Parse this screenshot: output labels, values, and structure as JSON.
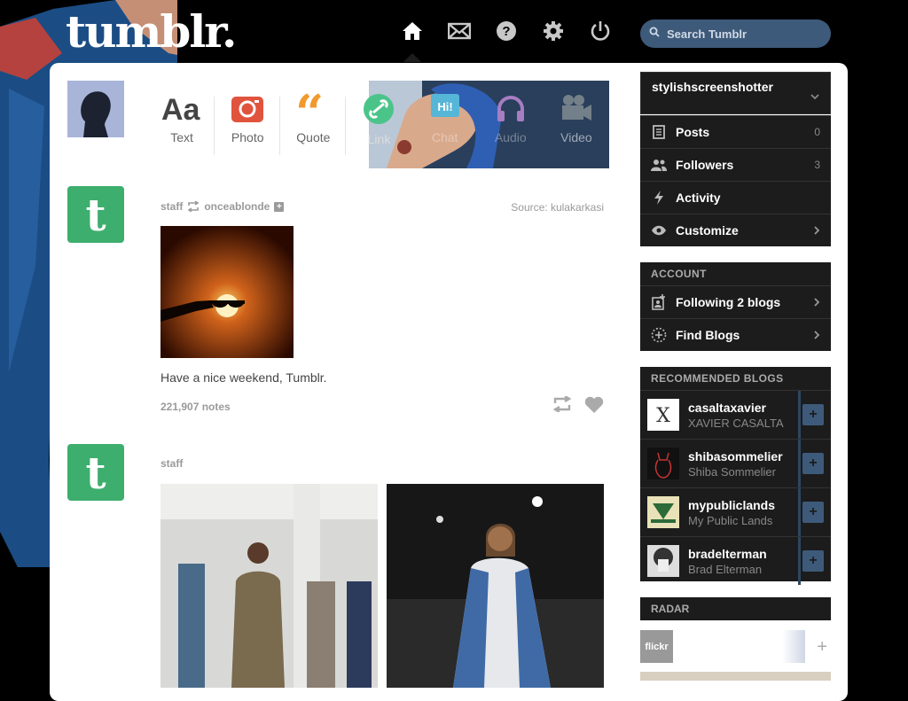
{
  "header": {
    "logo": "tumblr.",
    "nav": [
      "home-icon",
      "mail-icon",
      "help-icon",
      "settings-icon",
      "power-icon"
    ],
    "search_placeholder": "Search Tumblr"
  },
  "post_bar": [
    {
      "label": "Text",
      "icon": "text-icon",
      "color": "#444444"
    },
    {
      "label": "Photo",
      "icon": "camera-icon",
      "color": "#e0533d"
    },
    {
      "label": "Quote",
      "icon": "quote-icon",
      "color": "#f2992e"
    },
    {
      "label": "Link",
      "icon": "link-icon",
      "color": "#4bc48a"
    },
    {
      "label": "Chat",
      "icon": "chat-icon",
      "color": "#56b6d8"
    },
    {
      "label": "Audio",
      "icon": "headphones-icon",
      "color": "#a77dc2"
    },
    {
      "label": "Video",
      "icon": "video-icon",
      "color": "#748089"
    }
  ],
  "posts": [
    {
      "author": "staff",
      "reblogged_from": "onceablonde",
      "source": "Source: kulakarkasi",
      "caption": "Have a nice weekend, Tumblr.",
      "notes": "221,907 notes"
    },
    {
      "author": "staff"
    }
  ],
  "sidebar": {
    "blog_name": "stylishscreenshotter",
    "menu": [
      {
        "label": "Posts",
        "count": "0",
        "icon": "posts-icon"
      },
      {
        "label": "Followers",
        "count": "3",
        "icon": "followers-icon"
      },
      {
        "label": "Activity",
        "count": "",
        "icon": "activity-icon"
      },
      {
        "label": "Customize",
        "count": "",
        "icon": "eye-icon"
      }
    ],
    "account_title": "ACCOUNT",
    "account": [
      {
        "label": "Following 2 blogs",
        "icon": "following-icon"
      },
      {
        "label": "Find Blogs",
        "icon": "find-blogs-icon"
      }
    ],
    "recommended_title": "RECOMMENDED BLOGS",
    "recommended": [
      {
        "name": "casaltaxavier",
        "sub": "XAVIER CASALTA"
      },
      {
        "name": "shibasommelier",
        "sub": "Shiba Sommelier"
      },
      {
        "name": "mypubliclands",
        "sub": "My Public Lands"
      },
      {
        "name": "bradelterman",
        "sub": "Brad Elterman"
      }
    ],
    "radar_title": "RADAR",
    "radar_badge": "flickr"
  },
  "colors": {
    "accent": "#3e5a7a",
    "tumblr_green": "#3dae6e"
  }
}
